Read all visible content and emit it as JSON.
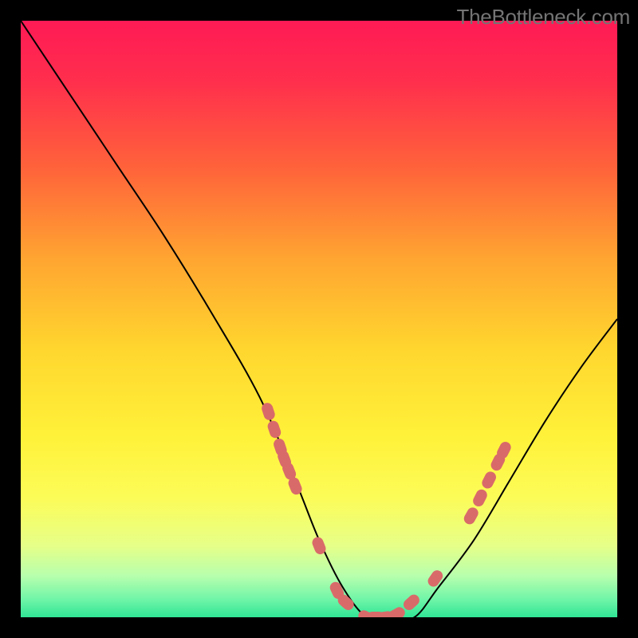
{
  "watermark": "TheBottleneck.com",
  "chart_data": {
    "type": "line",
    "title": "",
    "xlabel": "",
    "ylabel": "",
    "xlim": [
      0,
      100
    ],
    "ylim": [
      0,
      100
    ],
    "grid": false,
    "series": [
      {
        "name": "bottleneck-curve",
        "x": [
          0,
          8,
          16,
          24,
          32,
          40,
          46,
          50,
          54,
          58,
          62,
          66,
          70,
          76,
          82,
          88,
          94,
          100
        ],
        "y": [
          100,
          88,
          76,
          64,
          51,
          37,
          23,
          13,
          5,
          0,
          0,
          0,
          5,
          13,
          23,
          33,
          42,
          50
        ]
      }
    ],
    "markers": {
      "name": "bottleneck-markers",
      "color": "#d96a6a",
      "points": [
        {
          "x": 41.5,
          "y": 34.5
        },
        {
          "x": 42.5,
          "y": 31.5
        },
        {
          "x": 43.5,
          "y": 28.5
        },
        {
          "x": 44.2,
          "y": 26.5
        },
        {
          "x": 45.0,
          "y": 24.5
        },
        {
          "x": 46.0,
          "y": 22.0
        },
        {
          "x": 50.0,
          "y": 12.0
        },
        {
          "x": 53.0,
          "y": 4.5
        },
        {
          "x": 54.5,
          "y": 2.5
        },
        {
          "x": 58.0,
          "y": 0.0
        },
        {
          "x": 59.5,
          "y": 0.0
        },
        {
          "x": 61.0,
          "y": 0.0
        },
        {
          "x": 63.0,
          "y": 0.5
        },
        {
          "x": 65.5,
          "y": 2.5
        },
        {
          "x": 69.5,
          "y": 6.5
        },
        {
          "x": 75.5,
          "y": 17.0
        },
        {
          "x": 77.0,
          "y": 20.0
        },
        {
          "x": 78.5,
          "y": 23.0
        },
        {
          "x": 80.0,
          "y": 26.0
        },
        {
          "x": 81.0,
          "y": 28.0
        }
      ]
    },
    "gradient_stops": [
      {
        "offset": 0.0,
        "color": "#ff1a55"
      },
      {
        "offset": 0.1,
        "color": "#ff2e4d"
      },
      {
        "offset": 0.25,
        "color": "#ff643a"
      },
      {
        "offset": 0.4,
        "color": "#ffa531"
      },
      {
        "offset": 0.55,
        "color": "#ffd62e"
      },
      {
        "offset": 0.7,
        "color": "#fff23a"
      },
      {
        "offset": 0.8,
        "color": "#fcfc58"
      },
      {
        "offset": 0.88,
        "color": "#e6ff88"
      },
      {
        "offset": 0.93,
        "color": "#b8ffad"
      },
      {
        "offset": 0.97,
        "color": "#70f5a8"
      },
      {
        "offset": 1.0,
        "color": "#30e595"
      }
    ]
  }
}
